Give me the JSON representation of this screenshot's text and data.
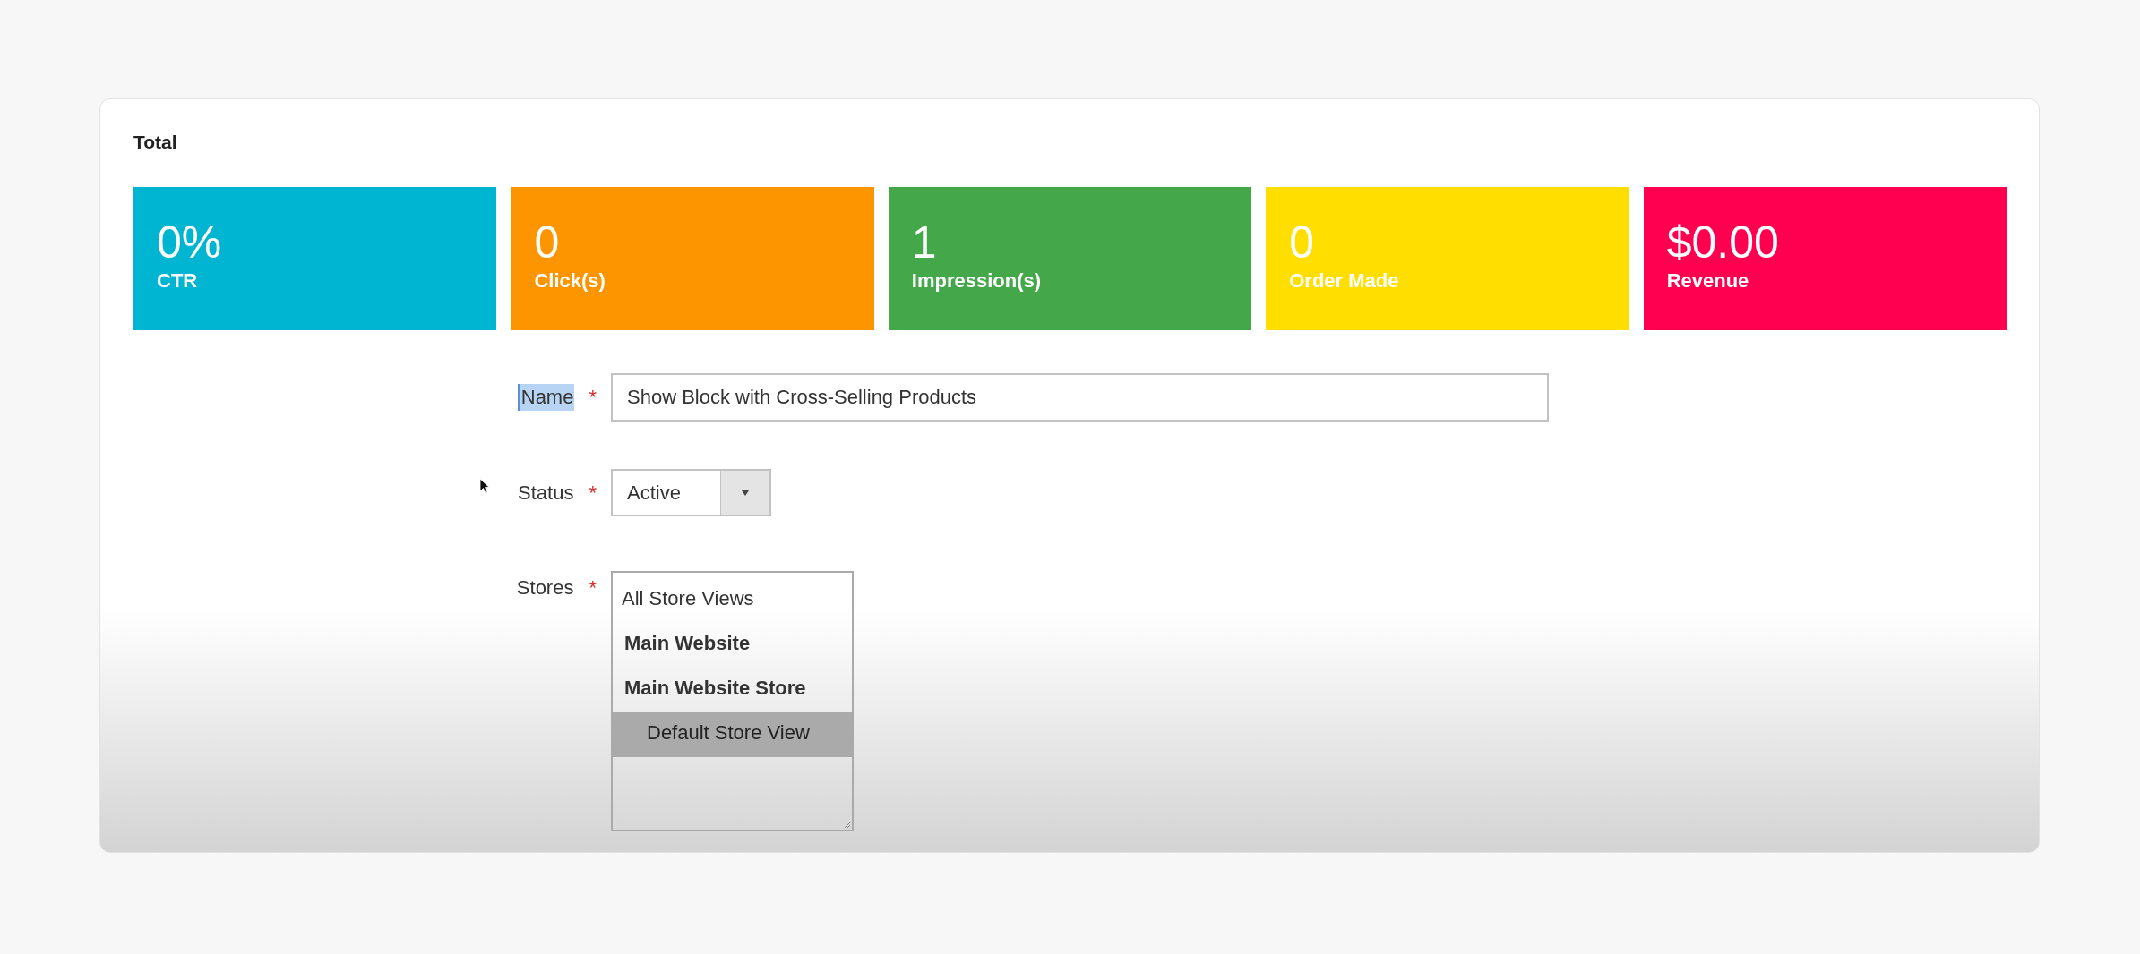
{
  "section_title": "Total",
  "stats": [
    {
      "value": "0%",
      "label": "CTR",
      "color": "#00b5d1"
    },
    {
      "value": "0",
      "label": "Click(s)",
      "color": "#fd9500"
    },
    {
      "value": "1",
      "label": "Impression(s)",
      "color": "#44a84b"
    },
    {
      "value": "0",
      "label": "Order Made",
      "color": "#ffde00"
    },
    {
      "value": "$0.00",
      "label": "Revenue",
      "color": "#ff0050"
    }
  ],
  "form": {
    "name": {
      "label": "Name",
      "required_mark": "*",
      "label_selected": true,
      "value": "Show Block with Cross-Selling Products"
    },
    "status": {
      "label": "Status",
      "required_mark": "*",
      "value": "Active"
    },
    "stores": {
      "label": "Stores",
      "required_mark": "*",
      "items": [
        {
          "label": "All Store Views",
          "kind": "option",
          "selected": false
        },
        {
          "label": "Main Website",
          "kind": "group",
          "selected": false,
          "children": [
            {
              "label": "Main Website Store",
              "kind": "group",
              "selected": false,
              "children": [
                {
                  "label": "Default Store View",
                  "kind": "option",
                  "selected": true
                }
              ]
            }
          ]
        }
      ]
    }
  }
}
